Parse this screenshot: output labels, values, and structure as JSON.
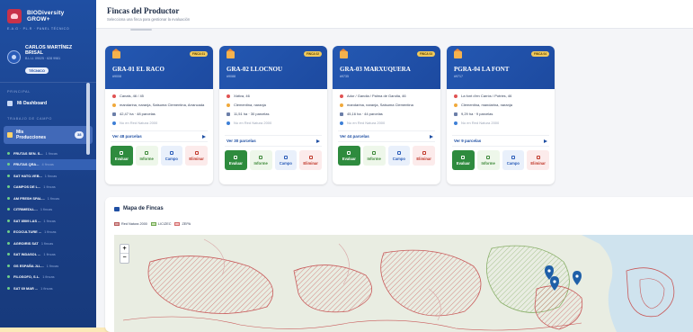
{
  "brand": {
    "name_line1": "BIODiversity",
    "name_line2": "GROW+"
  },
  "sidebar": {
    "breadcrumb": "E.A.G · PL.R · PANEL TÉCNICO",
    "user": {
      "name_line1": "CARLOS MARTÍNEZ",
      "name_line2": "BRISAL",
      "meta": "B.L.U. 09025 · 628 9981",
      "role": "TÉCNICO"
    },
    "section_principal": "PRINCIPAL",
    "dashboard_label": "Mi Dashboard",
    "section_campo": "TRABAJO DE CAMPO",
    "productions_label_line1": "Mis",
    "productions_label_line2": "Producciones",
    "productions_count": "38",
    "producers": [
      {
        "name": "FRUTAS SEN. S...",
        "sub": "1 fincas"
      },
      {
        "name": "FRUTAS QRA...",
        "sub": "4 fincas"
      },
      {
        "name": "SAT HATO-VEB...",
        "sub": "1 fincas"
      },
      {
        "name": "CAMPOS DE L...",
        "sub": "1 fincas"
      },
      {
        "name": "AM FRESH SPAL...",
        "sub": "1 fincas"
      },
      {
        "name": "CITRIMEDLL...",
        "sub": "1 fincas"
      },
      {
        "name": "SAT 8509 LAS ...",
        "sub": "1 fincas"
      },
      {
        "name": "ECOCULTURE ...",
        "sub": "1 fincas"
      },
      {
        "name": "AGROIRIS SAT",
        "sub": "1 fincas"
      },
      {
        "name": "SAT INDASOL ...",
        "sub": "1 fincas"
      },
      {
        "name": "GS ESPAÑA JLL...",
        "sub": "1 fincas"
      },
      {
        "name": "FILOSOFO, S.L.",
        "sub": "1 fincas"
      },
      {
        "name": "SAT 69 MAR ...",
        "sub": "1 fincas"
      }
    ]
  },
  "header": {
    "title": "Fincas del Productor",
    "subtitle": "Selecciona una finca para gestionar la evaluación"
  },
  "cards": [
    {
      "tag": "FINCA 01",
      "name": "GRA-01 EL RACO",
      "code": "#9008",
      "location": "Canals, 46 / 45",
      "crops": "mandarina, naranja, Satsuma Clementina, Arrancada",
      "area": "42,47 ha · 48 parcelas",
      "natura": "No en Red Natura 2000",
      "ver": "Ver 48 parcelas"
    },
    {
      "tag": "FINCA 02",
      "name": "GRA-02 LLOCNOU",
      "code": "#9088",
      "location": "Xàtiva, 46",
      "crops": "Clementina, naranja",
      "area": "11,51 ha · 30 parcelas",
      "natura": "No en Red Natura 2000",
      "ver": "Ver 30 parcelas"
    },
    {
      "tag": "FINCA 03",
      "name": "GRA-03 MARXUQUERA",
      "code": "#9735",
      "location": "Ador / Gandia / Palma de Gandia, 46",
      "crops": "mandarina, naranja, Satsuma Clementina",
      "area": "45,16 ha · 44 parcelas",
      "natura": "No en Red Natura 2000",
      "ver": "Ver 44 parcelas"
    },
    {
      "tag": "FINCA 04",
      "name": "PGRA-04 LA FONT",
      "code": "#9717",
      "location": "La font d'en Carròs / Potries, 46",
      "crops": "Clementina, mandarina, naranja",
      "area": "9,29 ha · 9 parcelas",
      "natura": "No en Red Natura 2000",
      "ver": "Ver 9 parcelas"
    }
  ],
  "actions": {
    "evaluar": "Evaluar",
    "informe": "Informe",
    "campo": "Campo",
    "eliminar": "Eliminar"
  },
  "map": {
    "title": "Mapa de Fincas",
    "legend": [
      {
        "label": "Red Natura 2000",
        "color": "#d7a5a5"
      },
      {
        "label": "LIC/ZEC",
        "color": "#c9e3b0"
      },
      {
        "label": "ZEPA",
        "color": "#f2c2c2"
      }
    ],
    "zoom_in": "+",
    "zoom_out": "−"
  },
  "colors": {
    "sidebar": "#1f4fa3",
    "card_header": "#2458b2",
    "evaluar": "#2e8b3e"
  }
}
